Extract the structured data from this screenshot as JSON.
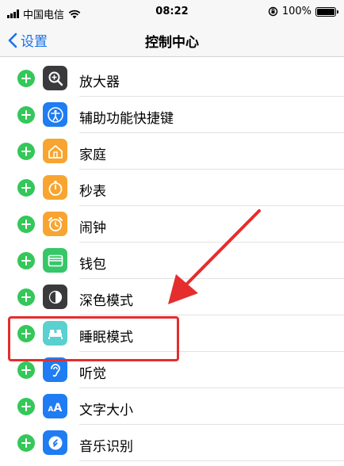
{
  "status_bar": {
    "carrier": "中国电信",
    "time": "08:22",
    "battery": "100%"
  },
  "nav": {
    "back_label": "设置",
    "title": "控制中心"
  },
  "items": [
    {
      "label": "放大器",
      "icon": "magnifier-icon",
      "color": "#3a3a3c"
    },
    {
      "label": "辅助功能快捷键",
      "icon": "accessibility-icon",
      "color": "#1f7cf2"
    },
    {
      "label": "家庭",
      "icon": "home-icon",
      "color": "#f7a530"
    },
    {
      "label": "秒表",
      "icon": "stopwatch-icon",
      "color": "#f7a530"
    },
    {
      "label": "闹钟",
      "icon": "alarm-icon",
      "color": "#f7a530"
    },
    {
      "label": "钱包",
      "icon": "wallet-icon",
      "color": "#36c769"
    },
    {
      "label": "深色模式",
      "icon": "dark-mode-icon",
      "color": "#3a3a3c"
    },
    {
      "label": "睡眠模式",
      "icon": "bed-icon",
      "color": "#5ad0cf"
    },
    {
      "label": "听觉",
      "icon": "ear-icon",
      "color": "#1f7cf2"
    },
    {
      "label": "文字大小",
      "icon": "text-size-icon",
      "color": "#1f7cf2"
    },
    {
      "label": "音乐识别",
      "icon": "shazam-icon",
      "color": "#1f7cf2"
    }
  ],
  "annotation": {
    "color": "#e52d2d"
  }
}
